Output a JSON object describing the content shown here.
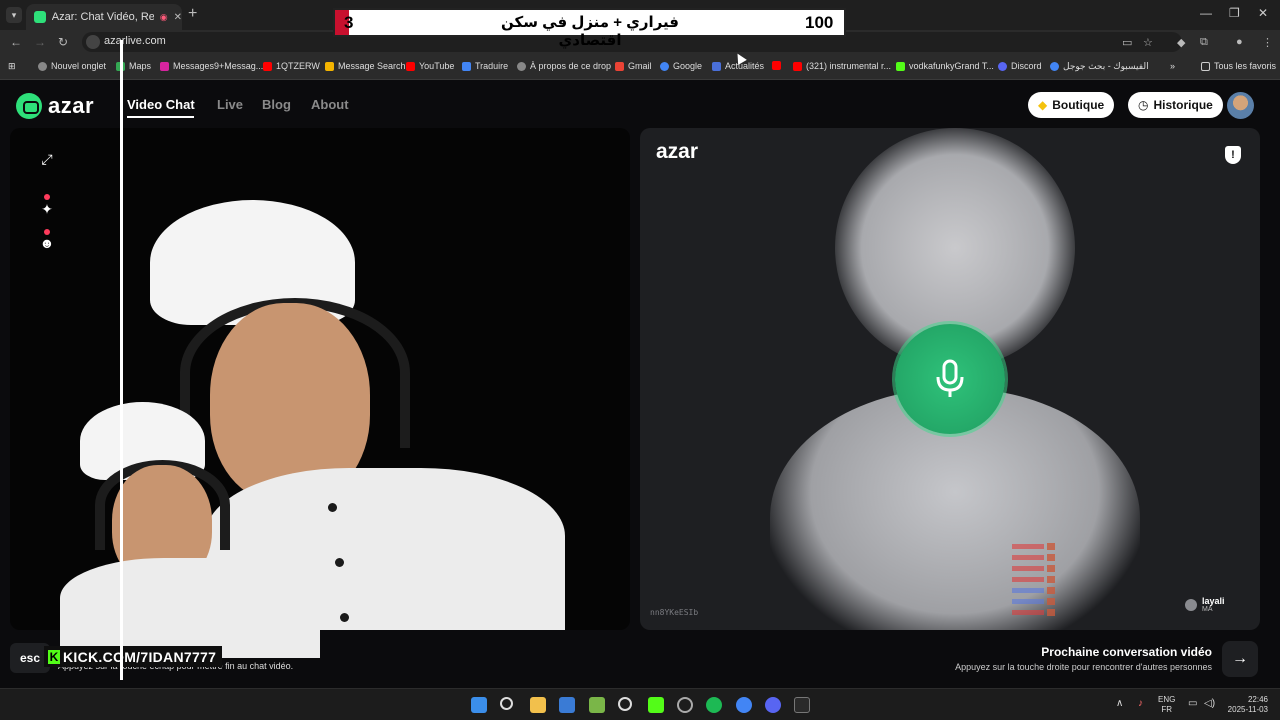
{
  "browser": {
    "tab_title": "Azar: Chat Vidéo, Rencontre",
    "url": "azarlive.com",
    "bookmarks": [
      "Nouvel onglet",
      "Maps",
      "Messages9+Messag...",
      "1QTZERW",
      "Message Search",
      "YouTube",
      "Traduire",
      "À propos de ce drop",
      "Gmail",
      "Google",
      "Actualités",
      "(321) instrumental r...",
      "vodkafunkyGrand T...",
      "Discord",
      "الفيسبوك - بحث جوجل"
    ],
    "all_bookmarks": "Tous les favoris"
  },
  "banner": {
    "left_number": "3",
    "text": "فيراري + منزل في سكن اقتصادي",
    "score": "100"
  },
  "app": {
    "brand": "azar",
    "nav": [
      "Video Chat",
      "Live",
      "Blog",
      "About"
    ],
    "active_nav": "Video Chat",
    "boutique_label": "Boutique",
    "historique_label": "Historique"
  },
  "peer": {
    "brand": "azar",
    "id": "nn8YKeESIb",
    "name": "layali",
    "country": "MA"
  },
  "bottom": {
    "esc_label": "esc",
    "esc_text": "Appuyez sur la touche échap pour mettre fin au chat vidéo.",
    "kick_text": "KICK.COM/7IDAN7777",
    "next_title": "Prochaine conversation vidéo",
    "next_sub": "Appuyez sur la touche droite pour rencontrer d'autres personnes"
  },
  "taskbar": {
    "lang_top": "ENG",
    "lang_bottom": "FR",
    "time": "22:46",
    "date": "2025-11-03"
  },
  "colors": {
    "accent": "#2ee07a",
    "mic": "#2fc27a",
    "kick": "#53fc18",
    "banner_red": "#c8102e"
  }
}
